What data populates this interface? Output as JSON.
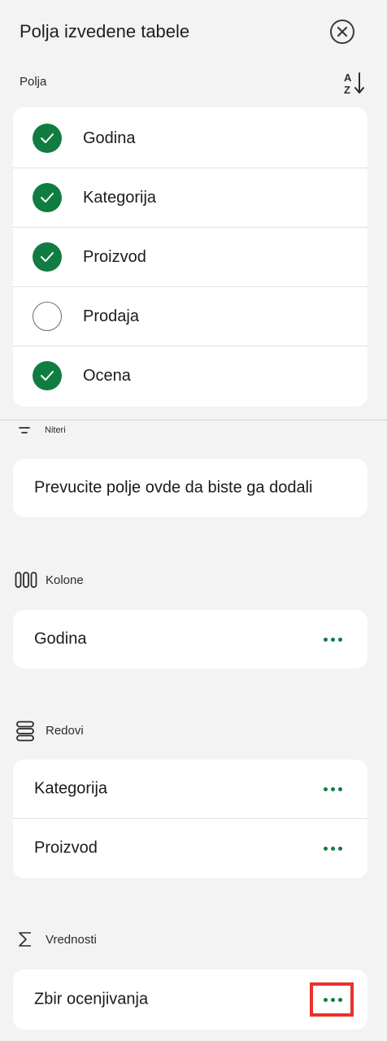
{
  "header": {
    "title": "Polja izvedene tabele",
    "close_icon": "close-circle-icon"
  },
  "fields_section": {
    "label": "Polja",
    "sort_icon": "sort-az-icon",
    "items": [
      {
        "label": "Godina",
        "checked": true
      },
      {
        "label": "Kategorija",
        "checked": true
      },
      {
        "label": "Proizvod",
        "checked": true
      },
      {
        "label": "Prodaja",
        "checked": false
      },
      {
        "label": "Ocena",
        "checked": true
      }
    ]
  },
  "filters": {
    "label": "Niteri",
    "icon": "filter-icon",
    "placeholder": "Prevucite polje ovde da biste ga dodali"
  },
  "columns": {
    "label": "Kolone",
    "icon": "columns-icon",
    "items": [
      "Godina"
    ]
  },
  "rows": {
    "label": "Redovi",
    "icon": "rows-icon",
    "items": [
      "Kategorija",
      "Proizvod"
    ]
  },
  "values": {
    "label": "Vrednosti",
    "icon": "sigma-icon",
    "items": [
      "Zbir ocenjivanja"
    ]
  },
  "colors": {
    "accent": "#107c41",
    "highlight": "#e8322b",
    "background": "#f3f3f3"
  }
}
